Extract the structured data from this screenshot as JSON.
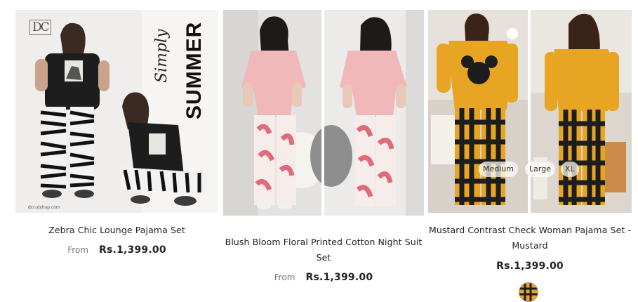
{
  "products": [
    {
      "title": "Zebra Chic Lounge Pajama Set",
      "from_label": "From",
      "price": "Rs.1,399.00",
      "image_text": {
        "logo": "DC",
        "script": "Simply",
        "headline": "SUMMER",
        "url": "dccutshop.com"
      }
    },
    {
      "title": "Blush Bloom Floral Printed Cotton Night Suit Set",
      "from_label": "From",
      "price": "Rs.1,399.00"
    },
    {
      "title": "Mustard Contrast Check Woman Pajama Set - Mustard",
      "price": "Rs.1,399.00",
      "sizes": [
        "Medium",
        "Large",
        "XL"
      ]
    }
  ],
  "colors": {
    "price": "#222222",
    "from": "#7b7b7b",
    "mustard": "#e8a524",
    "blush": "#f1b8b9",
    "black_tee": "#1d1d1d"
  }
}
